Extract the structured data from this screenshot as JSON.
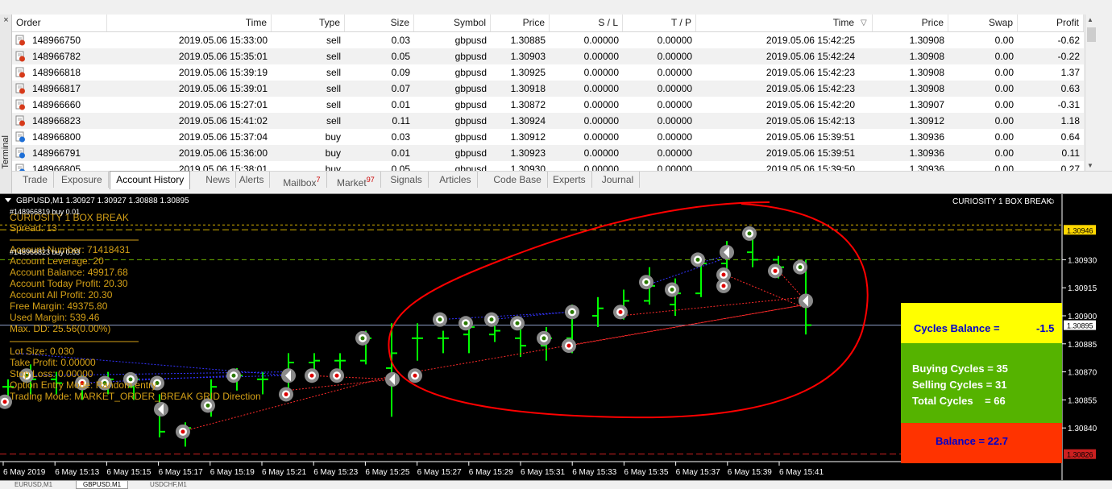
{
  "terminal": {
    "label": "Terminal",
    "close": "×"
  },
  "table": {
    "columns": [
      "Order",
      "Time",
      "Type",
      "Size",
      "Symbol",
      "Price",
      "S / L",
      "T / P",
      "Time",
      "Price",
      "Swap",
      "Profit"
    ],
    "sort_indicator": "▽",
    "rows": [
      {
        "order": "148966750",
        "time": "2019.05.06 15:33:00",
        "type": "sell",
        "size": "0.03",
        "symbol": "gbpusd",
        "price": "1.30885",
        "sl": "0.00000",
        "tp": "0.00000",
        "ctime": "2019.05.06 15:42:25",
        "cprice": "1.30908",
        "swap": "0.00",
        "profit": "-0.62",
        "icon": "red"
      },
      {
        "order": "148966782",
        "time": "2019.05.06 15:35:01",
        "type": "sell",
        "size": "0.05",
        "symbol": "gbpusd",
        "price": "1.30903",
        "sl": "0.00000",
        "tp": "0.00000",
        "ctime": "2019.05.06 15:42:24",
        "cprice": "1.30908",
        "swap": "0.00",
        "profit": "-0.22",
        "icon": "red"
      },
      {
        "order": "148966818",
        "time": "2019.05.06 15:39:19",
        "type": "sell",
        "size": "0.09",
        "symbol": "gbpusd",
        "price": "1.30925",
        "sl": "0.00000",
        "tp": "0.00000",
        "ctime": "2019.05.06 15:42:23",
        "cprice": "1.30908",
        "swap": "0.00",
        "profit": "1.37",
        "icon": "red"
      },
      {
        "order": "148966817",
        "time": "2019.05.06 15:39:01",
        "type": "sell",
        "size": "0.07",
        "symbol": "gbpusd",
        "price": "1.30918",
        "sl": "0.00000",
        "tp": "0.00000",
        "ctime": "2019.05.06 15:42:23",
        "cprice": "1.30908",
        "swap": "0.00",
        "profit": "0.63",
        "icon": "red"
      },
      {
        "order": "148966660",
        "time": "2019.05.06 15:27:01",
        "type": "sell",
        "size": "0.01",
        "symbol": "gbpusd",
        "price": "1.30872",
        "sl": "0.00000",
        "tp": "0.00000",
        "ctime": "2019.05.06 15:42:20",
        "cprice": "1.30907",
        "swap": "0.00",
        "profit": "-0.31",
        "icon": "red"
      },
      {
        "order": "148966823",
        "time": "2019.05.06 15:41:02",
        "type": "sell",
        "size": "0.11",
        "symbol": "gbpusd",
        "price": "1.30924",
        "sl": "0.00000",
        "tp": "0.00000",
        "ctime": "2019.05.06 15:42:13",
        "cprice": "1.30912",
        "swap": "0.00",
        "profit": "1.18",
        "icon": "red"
      },
      {
        "order": "148966800",
        "time": "2019.05.06 15:37:04",
        "type": "buy",
        "size": "0.03",
        "symbol": "gbpusd",
        "price": "1.30912",
        "sl": "0.00000",
        "tp": "0.00000",
        "ctime": "2019.05.06 15:39:51",
        "cprice": "1.30936",
        "swap": "0.00",
        "profit": "0.64",
        "icon": "blue"
      },
      {
        "order": "148966791",
        "time": "2019.05.06 15:36:00",
        "type": "buy",
        "size": "0.01",
        "symbol": "gbpusd",
        "price": "1.30923",
        "sl": "0.00000",
        "tp": "0.00000",
        "ctime": "2019.05.06 15:39:51",
        "cprice": "1.30936",
        "swap": "0.00",
        "profit": "0.11",
        "icon": "blue"
      },
      {
        "order": "148966805",
        "time": "2019.05.06 15:38:01",
        "type": "buy",
        "size": "0.05",
        "symbol": "gbpusd",
        "price": "1.30930",
        "sl": "0.00000",
        "tp": "0.00000",
        "ctime": "2019.05.06 15:39:50",
        "cprice": "1.30936",
        "swap": "0.00",
        "profit": "0.27",
        "icon": "blue"
      }
    ]
  },
  "tabs": [
    {
      "label": "Trade"
    },
    {
      "label": "Exposure"
    },
    {
      "label": "Account History",
      "active": true
    },
    {
      "label": "News"
    },
    {
      "label": "Alerts"
    },
    {
      "label": "Mailbox",
      "badge": "7"
    },
    {
      "label": "Market",
      "badge": "97"
    },
    {
      "label": "Signals"
    },
    {
      "label": "Articles"
    },
    {
      "label": "Code Base"
    },
    {
      "label": "Experts"
    },
    {
      "label": "Journal"
    }
  ],
  "chart": {
    "header": "GBPUSD,M1  1.30927 1.30927 1.30888 1.30895",
    "ea_name": "CURIOSITY 1 BOX BREAK",
    "price_labels": [
      "1.30930",
      "1.30915",
      "1.30900",
      "1.30885",
      "1.30870",
      "1.30855",
      "1.30840"
    ],
    "price_min": 1.30825,
    "price_max": 1.3095,
    "hl_top": "1.30946",
    "hl_bid": "1.30895",
    "hl_bottom": "1.30826",
    "time_labels": [
      "6 May 2019",
      "6 May 15:13",
      "6 May 15:15",
      "6 May 15:17",
      "6 May 15:19",
      "6 May 15:21",
      "6 May 15:23",
      "6 May 15:25",
      "6 May 15:27",
      "6 May 15:29",
      "6 May 15:31",
      "6 May 15:33",
      "6 May 15:35",
      "6 May 15:37",
      "6 May 15:39",
      "6 May 15:41"
    ],
    "order_labels": [
      "#148966819 buy 0.01",
      "#148966823 buy 0.03"
    ],
    "info": [
      "CURIOSITY 1 BOX BREAK",
      "Spread: 13",
      "Account Number: 71418431",
      "Account Leverage: 20",
      "Account Balance: 49917.68",
      "Account Today Profit: 20.30",
      "Account All Profit: 20.30",
      "Free Margin: 49375.80",
      "Used Margin: 539.46",
      "Max. DD: 25.56(0.00%)",
      "Lot Size: 0.030",
      "Take Profit: 0.00000",
      "Stop Loss: 0.00000",
      "Option Entry Mode:  Random entry",
      "Trading Mode: MARKET_ORDER_BREAK GRID Direction"
    ],
    "colors": {
      "candle": "#00ff00",
      "info": "#d4a017",
      "up_trade": "#3333ff",
      "down_trade": "#ff2a2a",
      "circle": "#ff0000"
    }
  },
  "panel": {
    "cycles_balance_label": "Cycles Balance =",
    "cycles_balance_value": "-1.5",
    "buying": "Buying Cycles = 35",
    "selling": "Selling Cycles = 31",
    "total": "Total Cycles    = 66",
    "balance": "Balance = 22.7",
    "colors": {
      "top": "#ffff00",
      "mid": "#55b300",
      "bottom": "#ff3300",
      "text_blue": "#0000cc",
      "text_white": "#ffffff"
    }
  },
  "bottom_tabs": [
    "EURUSD,M1",
    "GBPUSD,M1",
    "USDCHF,M1"
  ]
}
